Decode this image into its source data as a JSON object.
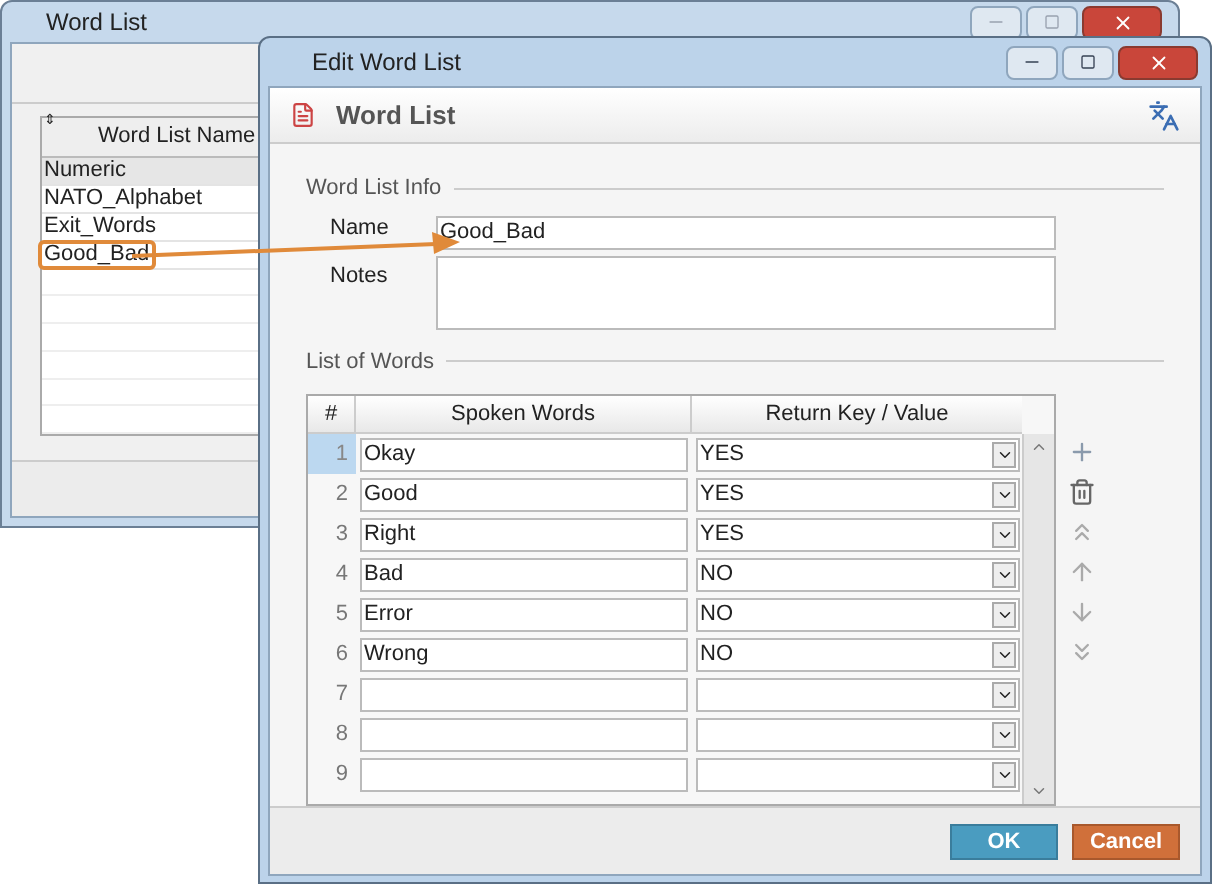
{
  "back_window": {
    "title": "Word List",
    "column_marker": "⇕",
    "column_header": "Word List Name",
    "items": [
      {
        "label": "Numeric",
        "selected": true,
        "callout": false
      },
      {
        "label": "NATO_Alphabet",
        "selected": false,
        "callout": false
      },
      {
        "label": "Exit_Words",
        "selected": false,
        "callout": false
      },
      {
        "label": "Good_Bad",
        "selected": false,
        "callout": true
      }
    ]
  },
  "dialog": {
    "title": "Edit Word List",
    "header": "Word List",
    "info_section": "Word List Info",
    "name_label": "Name",
    "name_value": "Good_Bad",
    "notes_label": "Notes",
    "words_section": "List of Words",
    "columns": [
      "#",
      "Spoken Words",
      "Return Key / Value"
    ],
    "rows": [
      {
        "number": "1",
        "word": "Okay",
        "value": "YES",
        "selected": true
      },
      {
        "number": "2",
        "word": "Good",
        "value": "YES",
        "selected": false
      },
      {
        "number": "3",
        "word": "Right",
        "value": "YES",
        "selected": false
      },
      {
        "number": "4",
        "word": "Bad",
        "value": "NO",
        "selected": false
      },
      {
        "number": "5",
        "word": "Error",
        "value": "NO",
        "selected": false
      },
      {
        "number": "6",
        "word": "Wrong",
        "value": "NO",
        "selected": false
      },
      {
        "number": "7",
        "word": "",
        "value": "",
        "selected": false
      },
      {
        "number": "8",
        "word": "",
        "value": "",
        "selected": false
      },
      {
        "number": "9",
        "word": "",
        "value": "",
        "selected": false
      }
    ],
    "buttons": [
      {
        "label": "OK",
        "kind": "primary"
      },
      {
        "label": "Cancel",
        "kind": "cancel"
      }
    ]
  }
}
